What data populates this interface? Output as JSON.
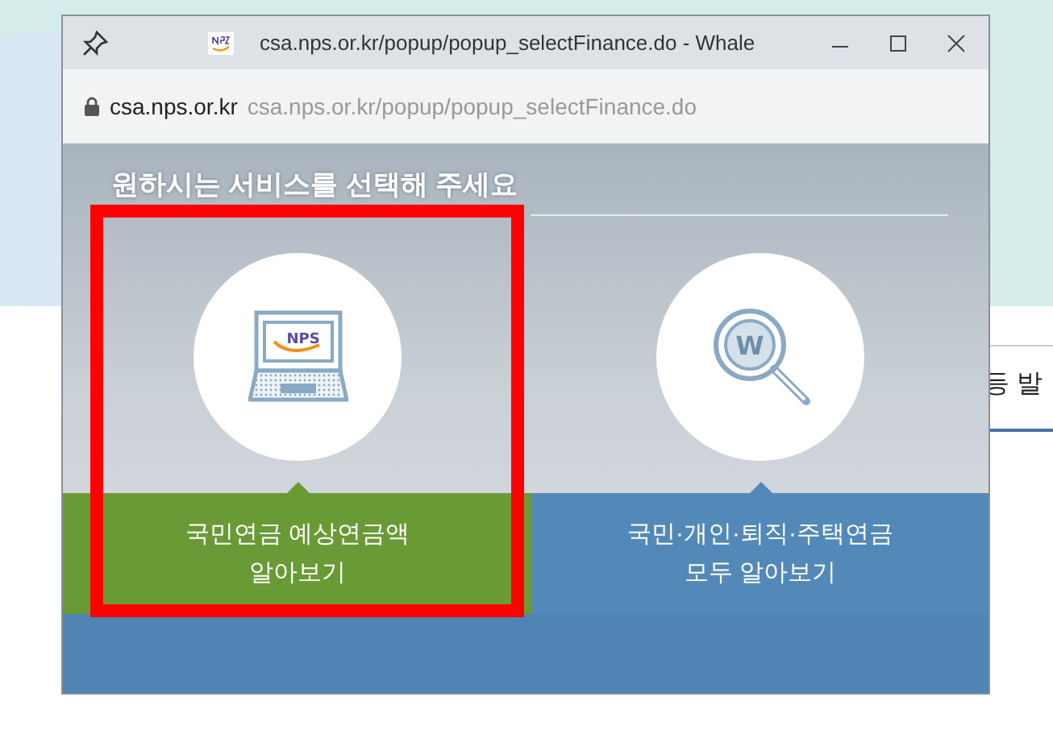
{
  "background_page": {
    "text": "등 발"
  },
  "window": {
    "title": "csa.nps.or.kr/popup/popup_selectFinance.do - Whale",
    "address": {
      "host": "csa.nps.or.kr",
      "url": "csa.nps.or.kr/popup/popup_selectFinance.do"
    }
  },
  "heading": "원하시는 서비스를 선택해 주세요",
  "services": [
    {
      "kind": "laptop",
      "logo": "NPS",
      "lines": [
        "국민연금 예상연금액",
        "알아보기"
      ],
      "color": "#6a9a35",
      "selected": true
    },
    {
      "kind": "search",
      "logo": "W",
      "lines": [
        "국민·개인·퇴직·주택연금",
        "모두 알아보기"
      ],
      "color": "#5389b8",
      "selected": false
    }
  ]
}
